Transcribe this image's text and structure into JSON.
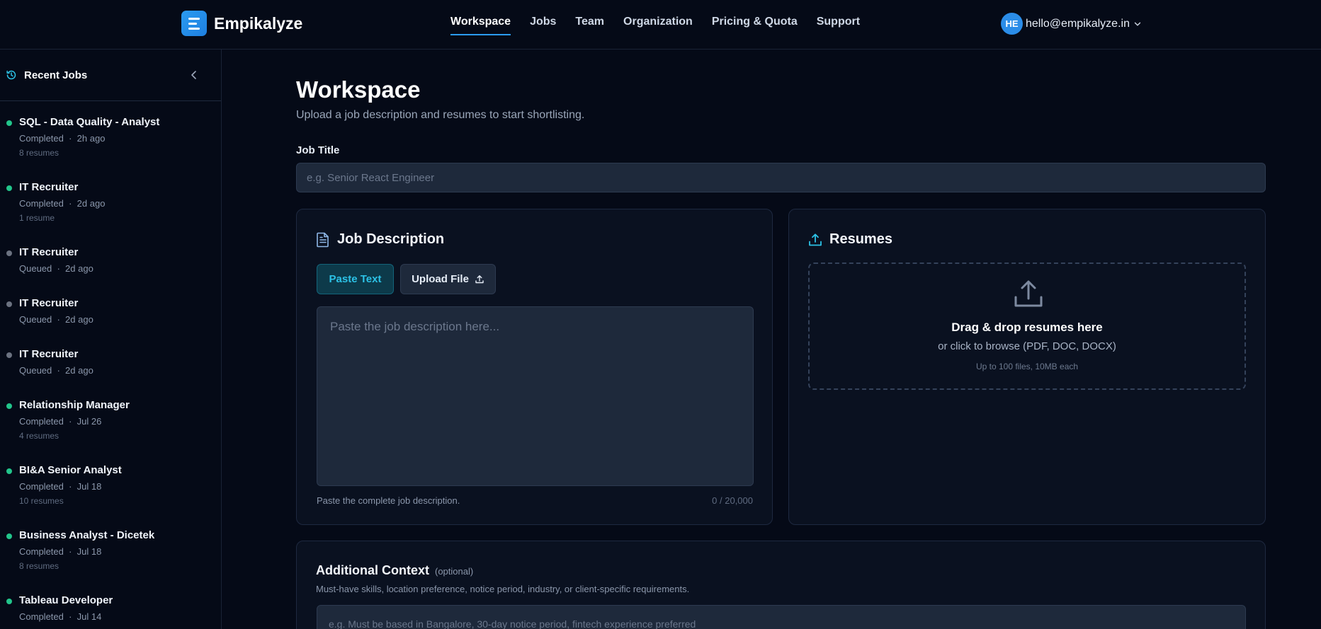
{
  "brand": {
    "name": "Empikalyze"
  },
  "nav": {
    "items": [
      {
        "label": "Workspace",
        "active": true
      },
      {
        "label": "Jobs",
        "active": false
      },
      {
        "label": "Team",
        "active": false
      },
      {
        "label": "Organization",
        "active": false
      },
      {
        "label": "Pricing & Quota",
        "active": false
      },
      {
        "label": "Support",
        "active": false
      }
    ]
  },
  "user": {
    "initials": "HE",
    "email": "hello@empikalyze.in"
  },
  "sidebar": {
    "title": "Recent Jobs",
    "jobs": [
      {
        "title": "SQL - Data Quality - Analyst",
        "status": "Completed",
        "time": "2h ago",
        "count": "8 resumes"
      },
      {
        "title": "IT Recruiter",
        "status": "Completed",
        "time": "2d ago",
        "count": "1 resume"
      },
      {
        "title": "IT Recruiter",
        "status": "Queued",
        "time": "2d ago",
        "count": ""
      },
      {
        "title": "IT Recruiter",
        "status": "Queued",
        "time": "2d ago",
        "count": ""
      },
      {
        "title": "IT Recruiter",
        "status": "Queued",
        "time": "2d ago",
        "count": ""
      },
      {
        "title": "Relationship Manager",
        "status": "Completed",
        "time": "Jul 26",
        "count": "4 resumes"
      },
      {
        "title": "BI&A Senior Analyst",
        "status": "Completed",
        "time": "Jul 18",
        "count": "10 resumes"
      },
      {
        "title": "Business Analyst - Dicetek",
        "status": "Completed",
        "time": "Jul 18",
        "count": "8 resumes"
      },
      {
        "title": "Tableau Developer",
        "status": "Completed",
        "time": "Jul 14",
        "count": ""
      }
    ]
  },
  "main": {
    "title": "Workspace",
    "subtitle": "Upload a job description and resumes to start shortlisting.",
    "job_title_label": "Job Title",
    "job_title_placeholder": "e.g. Senior React Engineer",
    "jd": {
      "title": "Job Description",
      "tab_paste": "Paste Text",
      "tab_upload": "Upload File",
      "placeholder": "Paste the job description here...",
      "hint": "Paste the complete job description.",
      "counter": "0 / 20,000"
    },
    "resumes": {
      "title": "Resumes",
      "drop_title": "Drag & drop resumes here",
      "drop_sub": "or click to browse (PDF, DOC, DOCX)",
      "drop_limit": "Up to 100 files, 10MB each"
    },
    "context": {
      "title": "Additional Context",
      "optional": "(optional)",
      "description": "Must-have skills, location preference, notice period, industry, or client-specific requirements.",
      "placeholder": "e.g. Must be based in Bangalore, 30-day notice period, fintech experience preferred"
    }
  },
  "colors": {
    "accent": "#2b9bf0",
    "completed": "#22c58b",
    "queued": "#6b7280",
    "paste_tab": "#2cc2e6"
  }
}
